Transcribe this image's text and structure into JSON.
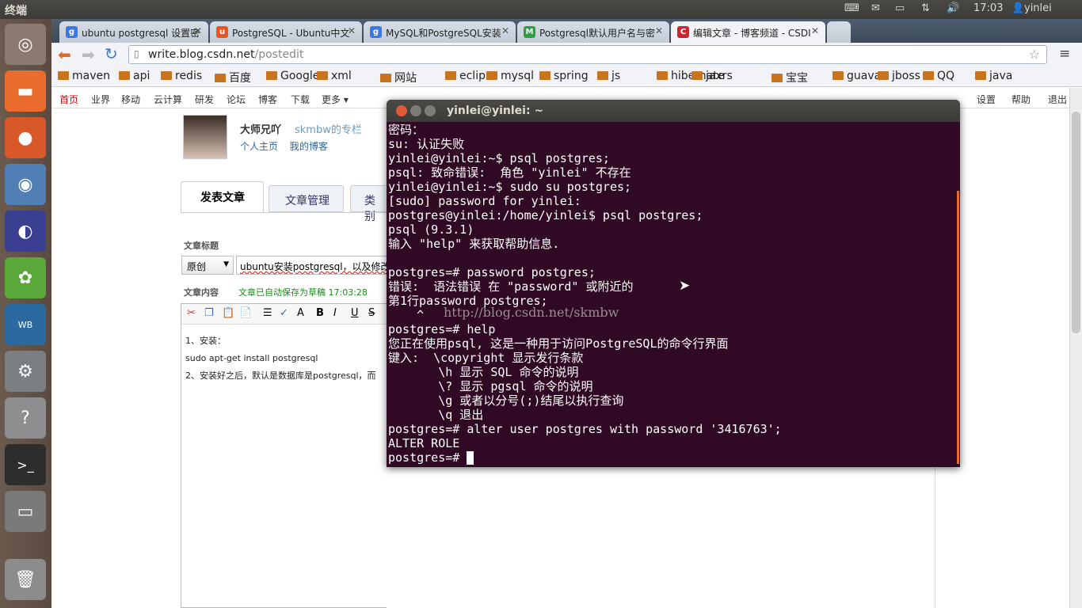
{
  "topbar": {
    "title": "终端",
    "time": "17:03",
    "user": "yinlei"
  },
  "browser": {
    "tabs": [
      {
        "label": "ubuntu postgresql 设置密",
        "fav": "g",
        "color": "#3b78e7"
      },
      {
        "label": "PostgreSQL - Ubuntu中文",
        "fav": "u",
        "color": "#e95420"
      },
      {
        "label": "MySQL和PostgreSQL安装",
        "fav": "g",
        "color": "#3b78e7"
      },
      {
        "label": "Postgresql默认用户名与密",
        "fav": "M",
        "color": "#2ea043"
      },
      {
        "label": "编辑文章 - 博客频道 - CSDI",
        "fav": "C",
        "color": "#c9272d"
      }
    ],
    "url_host": "write.blog.csdn.net",
    "url_path": "/postedit",
    "bookmarks": [
      "maven",
      "api",
      "redis",
      "百度",
      "Google",
      "xml",
      "网站",
      "eclipse",
      "mysql",
      "spring",
      "js",
      "hibernate",
      "jaxrs",
      "宝宝",
      "guava",
      "jboss",
      "QQ",
      "java"
    ]
  },
  "csdn": {
    "nav": [
      "首页",
      "业界",
      "移动",
      "云计算",
      "研发",
      "论坛",
      "博客",
      "下载",
      "更多 ▾"
    ],
    "nav_right": [
      "设置",
      "帮助",
      "退出"
    ],
    "author_name": "大师兄吖",
    "column": "skmbw的专栏",
    "home_link": "个人主页",
    "blog_link": "我的博客",
    "tabs": [
      "发表文章",
      "文章管理",
      "类别"
    ],
    "title_label": "文章标题",
    "type_select": "原创",
    "title_value": "ubuntu安装postgresql，以及修改默",
    "content_label": "文章内容",
    "autosave": "文章已自动保存为草稿 17:03:28",
    "content_lines": [
      "1、安装：",
      "sudo apt-get install postgresql",
      "2、安装好之后，默认是数据库是postgresql，而"
    ]
  },
  "terminal": {
    "title": "yinlei@yinlei: ~",
    "lines": [
      "密码：",
      "su: 认证失败",
      "yinlei@yinlei:~$ psql postgres;",
      "psql: 致命错误:  角色 \"yinlei\" 不存在",
      "yinlei@yinlei:~$ sudo su postgres;",
      "[sudo] password for yinlei:",
      "postgres@yinlei:/home/yinlei$ psql postgres;",
      "psql (9.3.1)",
      "输入 \"help\" 来获取帮助信息.",
      "",
      "postgres=# password postgres;",
      "错误:  语法错误 在 \"password\" 或附近的",
      "第1行password postgres;",
      "    ^",
      "postgres=# help",
      "您正在使用psql, 这是一种用于访问PostgreSQL的命令行界面",
      "键入:  \\copyright 显示发行条款",
      "       \\h 显示 SQL 命令的说明",
      "       \\? 显示 pgsql 命令的说明",
      "       \\g 或者以分号(;)结尾以执行查询",
      "       \\q 退出",
      "postgres=# alter user postgres with password '3416763';",
      "ALTER ROLE",
      "postgres=# "
    ],
    "watermark": "http://blog.csdn.net/skmbw"
  }
}
